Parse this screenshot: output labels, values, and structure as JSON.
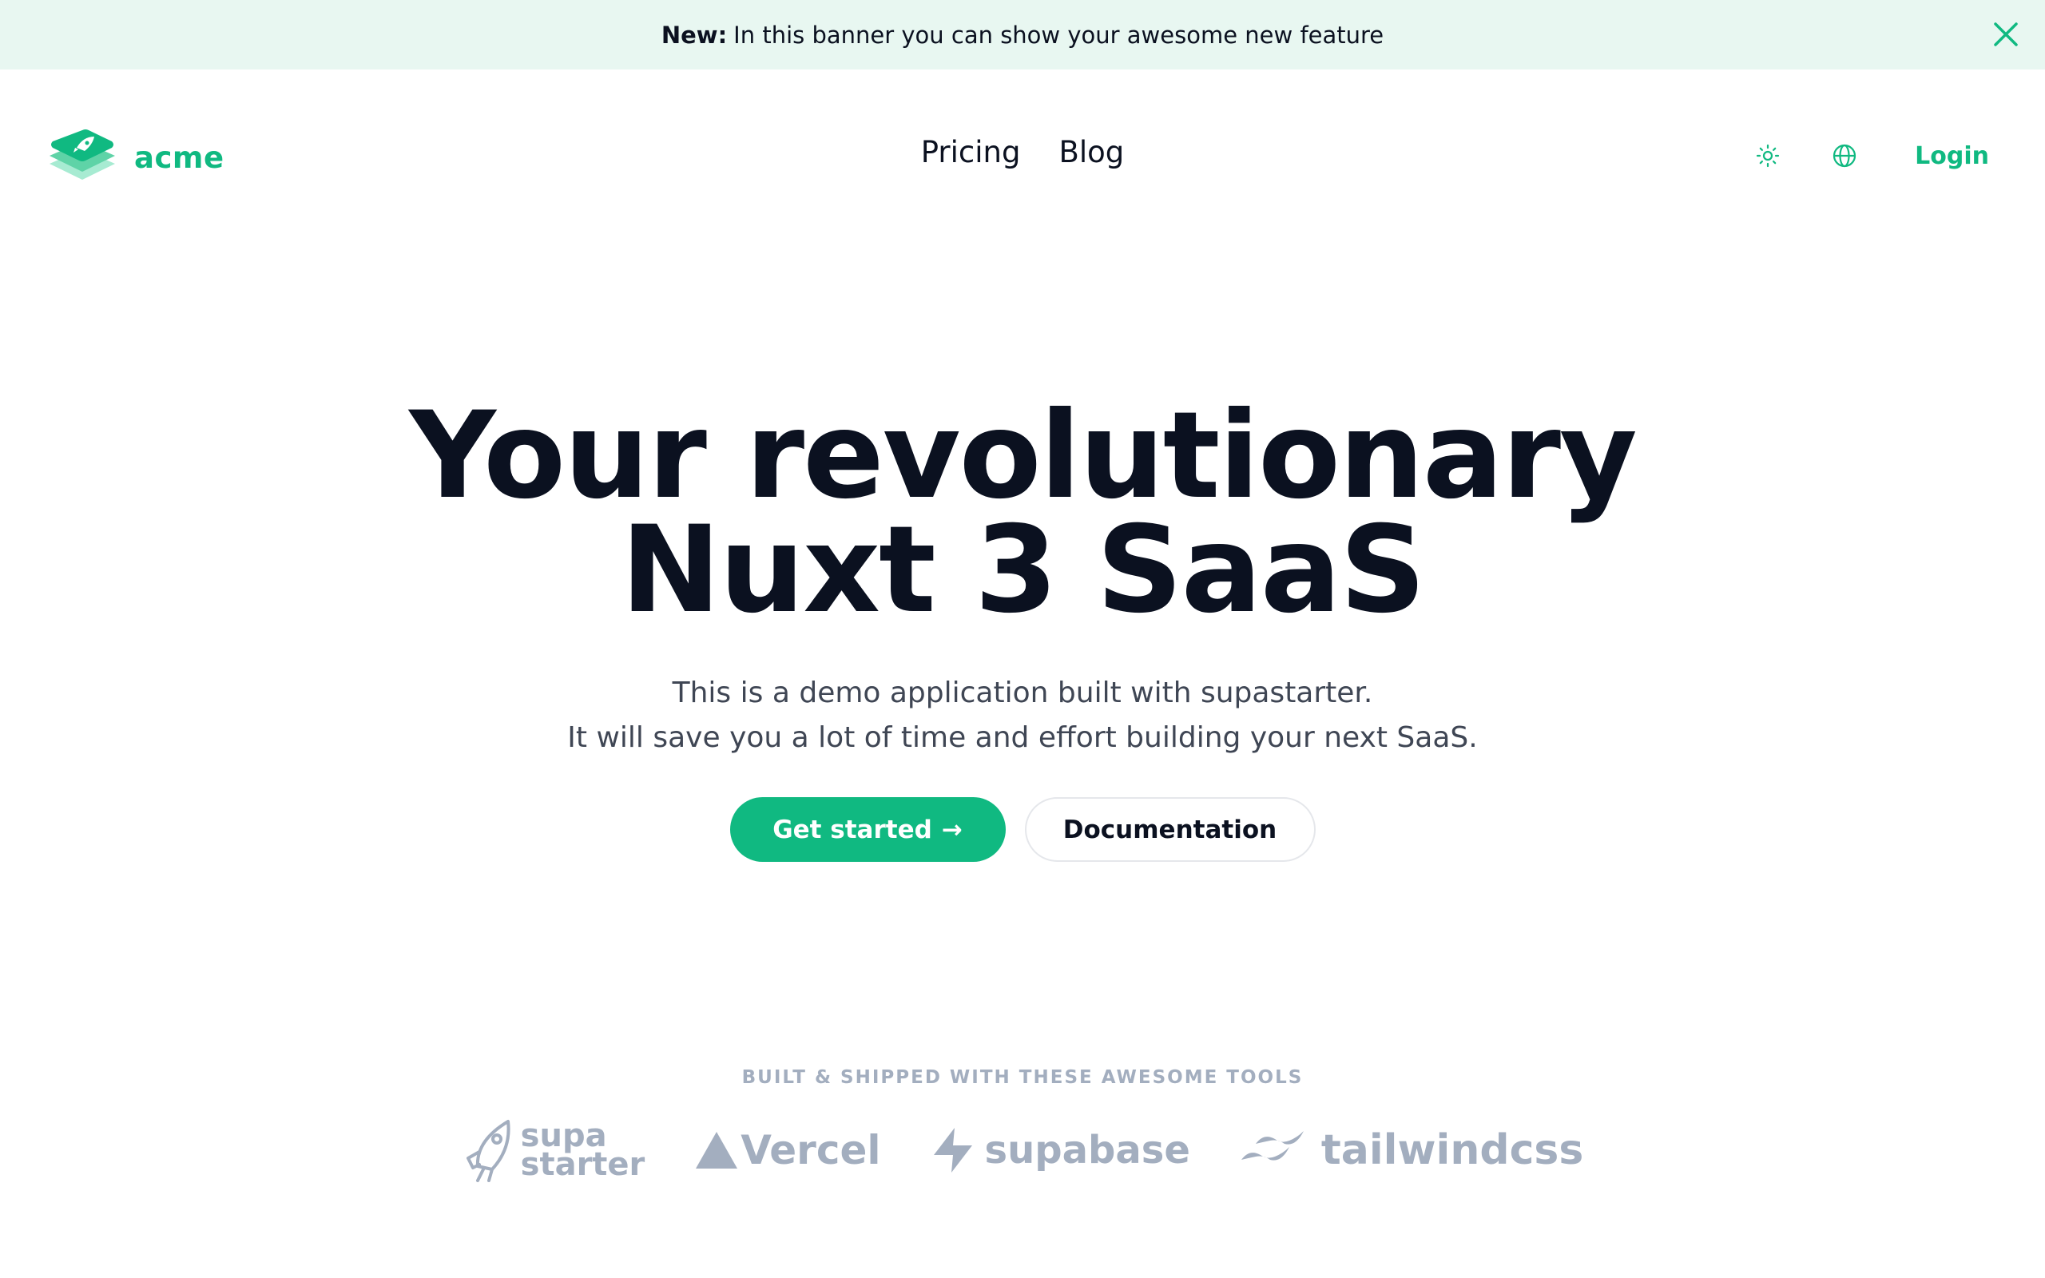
{
  "banner": {
    "strong": "New:",
    "text": "In this banner you can show your awesome new feature",
    "close_icon": "close-icon"
  },
  "navbar": {
    "brand": "acme",
    "links": [
      "Pricing",
      "Blog"
    ],
    "theme_icon": "sun-icon",
    "language_icon": "globe-icon",
    "login": "Login"
  },
  "hero": {
    "title_line1": "Your revolutionary",
    "title_line2": "Nuxt 3 SaaS",
    "subtitle_line1": "This is a demo application built with supastarter.",
    "subtitle_line2": "It will save you a lot of time and effort building your next SaaS.",
    "primary_cta": "Get started",
    "primary_cta_arrow": "→",
    "secondary_cta": "Documentation"
  },
  "tools": {
    "label": "BUILT & SHIPPED WITH THESE AWESOME TOOLS",
    "supastarter": [
      "supa",
      "starter"
    ],
    "vercel": "Vercel",
    "supabase": "supabase",
    "tailwind": "tailwindcss"
  },
  "colors": {
    "accent": "#10b981",
    "banner_bg": "#e8f7f1",
    "muted": "#a3aebf",
    "text": "#0b1120"
  }
}
